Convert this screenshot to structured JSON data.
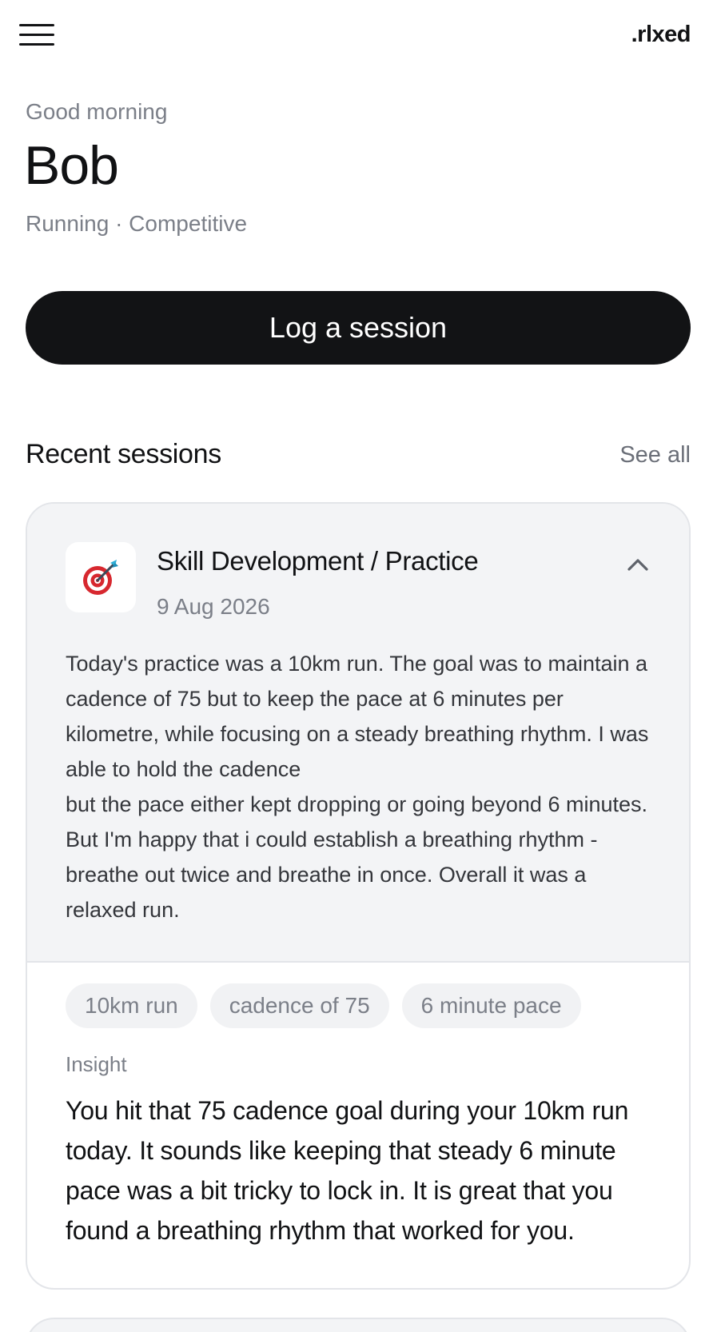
{
  "header": {
    "brand": ".rlxed",
    "menu_icon": "hamburger-icon"
  },
  "profile": {
    "greeting": "Good morning",
    "name": "Bob",
    "sport_meta": "Running · Competitive"
  },
  "actions": {
    "log_session_label": "Log a session"
  },
  "recent": {
    "title": "Recent sessions",
    "see_all_label": "See all",
    "sessions": [
      {
        "icon": "target-dart-icon",
        "title": "Skill Development / Practice",
        "date": "9 Aug 2026",
        "expanded": true,
        "notes": "Today's practice was a 10km run. The goal was to maintain a cadence of 75 but to keep the pace at 6 minutes per kilometre, while focusing on a steady breathing rhythm. I was able to hold the cadence\nbut the pace either kept dropping or going beyond 6 minutes. But I'm happy that i could establish a breathing rhythm - breathe out twice and breathe in once. Overall it was a relaxed run.",
        "tags": [
          "10km run",
          "cadence of 75",
          "6 minute pace"
        ],
        "insight_label": "Insight",
        "insight": "You hit that 75 cadence goal during your 10km run today. It sounds like keeping that steady 6 minute pace was a bit tricky to lock in. It is great that you found a breathing rhythm that worked for you."
      }
    ]
  },
  "colors": {
    "primary_button": "#121315",
    "muted_text": "#7b7f88",
    "card_background": "#f3f4f6",
    "card_border": "#e3e5e9"
  }
}
